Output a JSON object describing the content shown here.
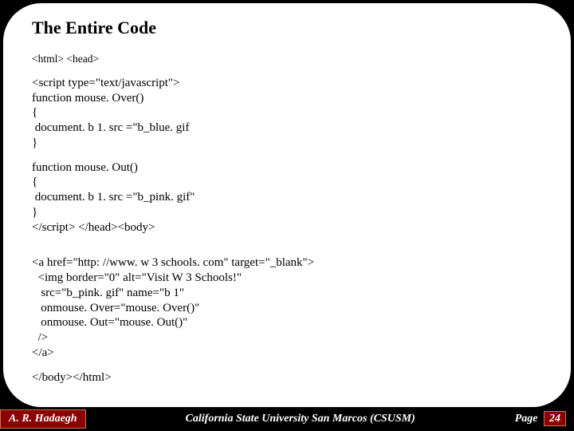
{
  "slide": {
    "title": "The Entire Code",
    "line1": "<html> <head>",
    "block2_l1": "<script type=\"text/javascript\">",
    "block2_l2": "function mouse. Over()",
    "block2_l3": "{",
    "block2_l4": " document. b 1. src =\"b_blue. gif",
    "block2_l5": "}",
    "block3_l1": "function mouse. Out()",
    "block3_l2": "{",
    "block3_l3": " document. b 1. src =\"b_pink. gif\"",
    "block3_l4": "}",
    "block3_l5": "</script> </head><body>",
    "block4_l1": "<a href=\"http: //www. w 3 schools. com\" target=\"_blank\">",
    "block4_l2": "  <img border=\"0\" alt=\"Visit W 3 Schools!\"",
    "block4_l3": "   src=\"b_pink. gif\" name=\"b 1\"",
    "block4_l4": "   onmouse. Over=\"mouse. Over()\"",
    "block4_l5": "   onmouse. Out=\"mouse. Out()\"",
    "block4_l6": "  />",
    "block4_l7": "</a>",
    "line_end": "</body></html>"
  },
  "footer": {
    "author": "A. R. Hadaegh",
    "institution": "California State University San Marcos (CSUSM)",
    "page_label": "Page",
    "page_number": "24"
  }
}
